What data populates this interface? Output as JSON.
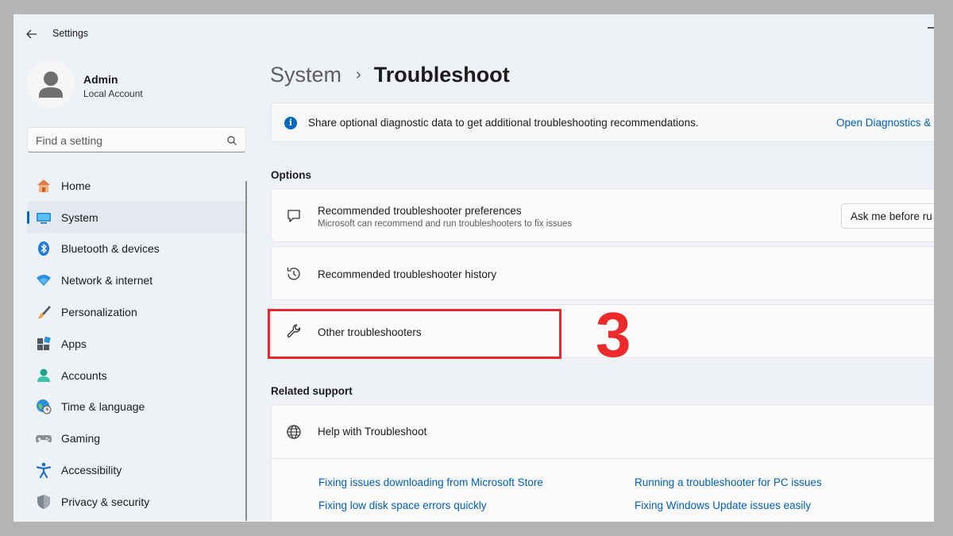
{
  "window": {
    "title": "Settings"
  },
  "profile": {
    "name": "Admin",
    "account_type": "Local Account"
  },
  "search": {
    "placeholder": "Find a setting"
  },
  "sidebar": {
    "items": [
      {
        "label": "Home",
        "icon": "home-icon",
        "active": false
      },
      {
        "label": "System",
        "icon": "system-icon",
        "active": true
      },
      {
        "label": "Bluetooth & devices",
        "icon": "bluetooth-icon",
        "active": false
      },
      {
        "label": "Network & internet",
        "icon": "wifi-icon",
        "active": false
      },
      {
        "label": "Personalization",
        "icon": "brush-icon",
        "active": false
      },
      {
        "label": "Apps",
        "icon": "apps-icon",
        "active": false
      },
      {
        "label": "Accounts",
        "icon": "accounts-icon",
        "active": false
      },
      {
        "label": "Time & language",
        "icon": "globe-clock-icon",
        "active": false
      },
      {
        "label": "Gaming",
        "icon": "gamepad-icon",
        "active": false
      },
      {
        "label": "Accessibility",
        "icon": "accessibility-icon",
        "active": false
      },
      {
        "label": "Privacy & security",
        "icon": "shield-icon",
        "active": false
      }
    ]
  },
  "breadcrumb": {
    "parent": "System",
    "separator": "›",
    "current": "Troubleshoot"
  },
  "info_bar": {
    "text": "Share optional diagnostic data to get additional troubleshooting recommendations.",
    "link": "Open Diagnostics &"
  },
  "options": {
    "title": "Options",
    "preferences": {
      "title": "Recommended troubleshooter preferences",
      "subtitle": "Microsoft can recommend and run troubleshooters to fix issues",
      "dropdown_value": "Ask me before ru"
    },
    "history": {
      "title": "Recommended troubleshooter history"
    },
    "other": {
      "title": "Other troubleshooters"
    }
  },
  "annotation": {
    "step_number": "3",
    "color": "#ec2a2a"
  },
  "related_support": {
    "title": "Related support",
    "help_title": "Help with Troubleshoot",
    "links": [
      "Fixing issues downloading from Microsoft Store",
      "Running a troubleshooter for PC issues",
      "Fixing low disk space errors quickly",
      "Fixing Windows Update issues easily"
    ]
  },
  "colors": {
    "accent": "#0067c0",
    "link": "#005fb8",
    "annotation_red": "#e8262b"
  }
}
